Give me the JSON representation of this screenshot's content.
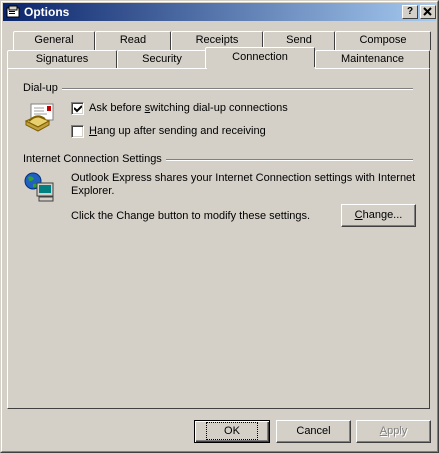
{
  "window": {
    "title": "Options",
    "help_button": "?",
    "close_button": "✕"
  },
  "tabs_back": [
    "General",
    "Read",
    "Receipts",
    "Send",
    "Compose"
  ],
  "tabs_front": [
    "Signatures",
    "Security",
    "Connection",
    "Maintenance"
  ],
  "active_tab": "Connection",
  "dialup": {
    "group_label": "Dial-up",
    "ask_before_switching": {
      "label_before": "Ask before ",
      "label_accel": "s",
      "label_after": "witching dial-up connections",
      "checked": true
    },
    "hang_up": {
      "label_before": "",
      "label_accel": "H",
      "label_after": "ang up after sending and receiving",
      "checked": false
    }
  },
  "internet": {
    "group_label": "Internet Connection Settings",
    "description_line1": "Outlook Express shares your Internet Connection settings with Internet",
    "description_line2": "Explorer.",
    "change_hint": "Click the Change button to modify these settings.",
    "change_button_before": "",
    "change_button_accel": "C",
    "change_button_after": "hange..."
  },
  "buttons": {
    "ok": "OK",
    "cancel": "Cancel",
    "apply_accel": "A",
    "apply_after": "pply",
    "apply_enabled": false
  },
  "colors": {
    "titlebar_start": "#0a246a",
    "titlebar_end": "#a6caf0",
    "face": "#d4d0c8"
  },
  "icons": [
    "window-app-icon",
    "dialup-phone-icon",
    "internet-connection-icon",
    "checkmark-icon"
  ]
}
